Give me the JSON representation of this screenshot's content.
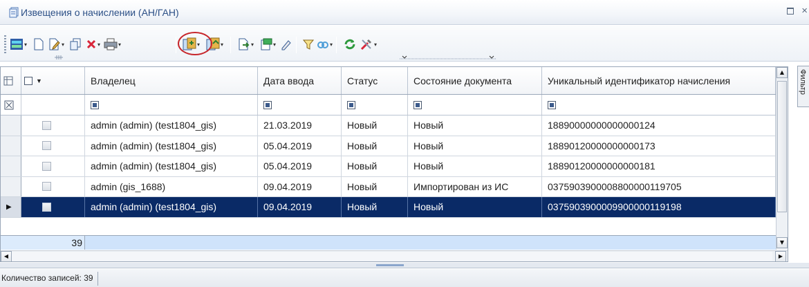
{
  "window": {
    "title": "Извещения о начислении (АН/ГАН)",
    "controls": [
      "restore-icon",
      "close-icon"
    ],
    "close_glyph": "×"
  },
  "toolbar": {
    "icons": [
      "refresh-fmp-icon",
      "new-document-icon",
      "edit-document-icon",
      "copy-document-icon",
      "delete-icon",
      "print-icon",
      "import-icon",
      "export-icon",
      "send-icon",
      "status-icon",
      "sign-icon",
      "filter-icon",
      "link-icon",
      "refresh-icon",
      "tools-icon"
    ],
    "highlighted_icon": "import-icon",
    "highlight_color": "#c7262b"
  },
  "grid": {
    "columns": [
      {
        "key": "owner",
        "label": "Владелец"
      },
      {
        "key": "date",
        "label": "Дата ввода"
      },
      {
        "key": "status",
        "label": "Статус"
      },
      {
        "key": "state",
        "label": "Состояние документа"
      },
      {
        "key": "uin",
        "label": "Уникальный идентификатор начисления"
      }
    ],
    "rows": [
      {
        "owner": "admin (admin) (test1804_gis)",
        "date": "21.03.2019",
        "status": "Новый",
        "state": "Новый",
        "uin": "18890000000000000124",
        "selected": false
      },
      {
        "owner": "admin (admin) (test1804_gis)",
        "date": "05.04.2019",
        "status": "Новый",
        "state": "Новый",
        "uin": "18890120000000000173",
        "selected": false
      },
      {
        "owner": "admin (admin) (test1804_gis)",
        "date": "05.04.2019",
        "status": "Новый",
        "state": "Новый",
        "uin": "18890120000000000181",
        "selected": false
      },
      {
        "owner": "admin (gis_1688)",
        "date": "09.04.2019",
        "status": "Новый",
        "state": "Импортирован из ИС",
        "uin": "03759039000088000001197 05",
        "selected": false
      },
      {
        "owner": "admin (admin) (test1804_gis)",
        "date": "09.04.2019",
        "status": "Новый",
        "state": "Новый",
        "uin": "0375903900009900000119198",
        "selected": true
      }
    ],
    "total_count": "39",
    "selected_color": "#0a2a66"
  },
  "side_panel": {
    "label": "Фильтр"
  },
  "statusbar": {
    "text": "Количество записей: 39"
  }
}
